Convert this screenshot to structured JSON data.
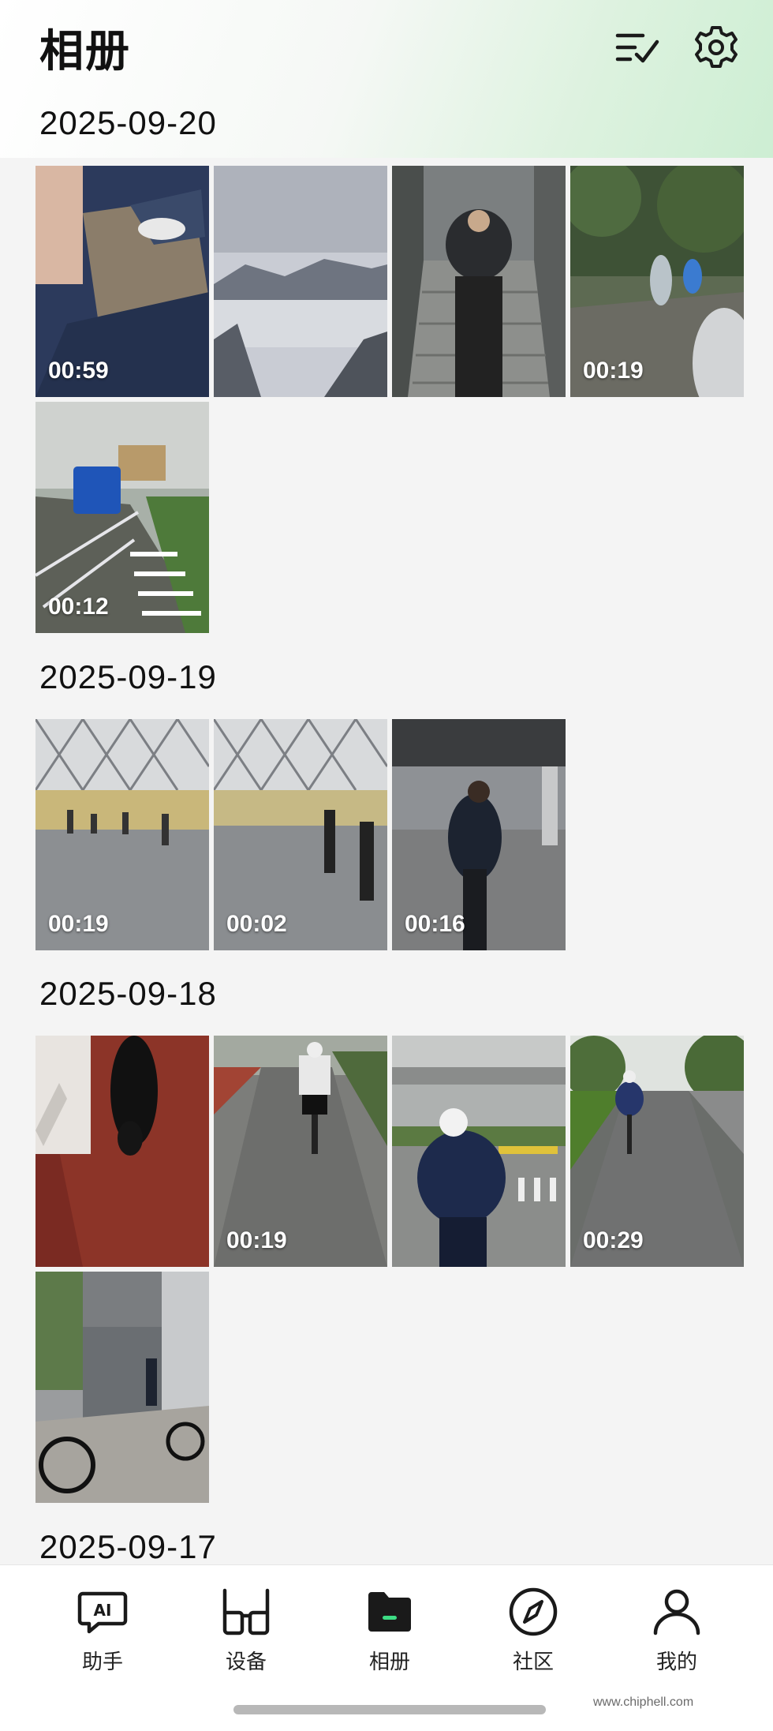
{
  "header": {
    "title": "相册",
    "select_icon": "checklist-icon",
    "settings_icon": "gear-icon"
  },
  "groups": [
    {
      "date": "2025-09-20",
      "items": [
        {
          "duration": "00:59",
          "scene": "ground-feet"
        },
        {
          "duration": "",
          "scene": "mountain-clouds"
        },
        {
          "duration": "",
          "scene": "stairs-hiker"
        },
        {
          "duration": "00:19",
          "scene": "forest-rain"
        },
        {
          "duration": "00:12",
          "scene": "road-bus"
        }
      ]
    },
    {
      "date": "2025-09-19",
      "items": [
        {
          "duration": "00:19",
          "scene": "airport-hall"
        },
        {
          "duration": "00:02",
          "scene": "airport-hall"
        },
        {
          "duration": "00:16",
          "scene": "airport-walker"
        }
      ]
    },
    {
      "date": "2025-09-18",
      "items": [
        {
          "duration": "",
          "scene": "dog-floor"
        },
        {
          "duration": "00:19",
          "scene": "cyclist-road"
        },
        {
          "duration": "",
          "scene": "cyclist-bridge"
        },
        {
          "duration": "00:29",
          "scene": "cyclist-park"
        },
        {
          "duration": "",
          "scene": "bike-building"
        }
      ]
    },
    {
      "date": "2025-09-17",
      "items": []
    }
  ],
  "nav": {
    "items": [
      {
        "label": "助手",
        "icon": "ai-assistant-icon",
        "active": false
      },
      {
        "label": "设备",
        "icon": "glasses-icon",
        "active": false
      },
      {
        "label": "相册",
        "icon": "folder-icon",
        "active": true
      },
      {
        "label": "社区",
        "icon": "compass-icon",
        "active": false
      },
      {
        "label": "我的",
        "icon": "person-icon",
        "active": false
      }
    ]
  },
  "watermark": "www.chiphell.com",
  "colors": {
    "accent": "#3ddc84",
    "text": "#111111",
    "background": "#f4f4f4"
  }
}
